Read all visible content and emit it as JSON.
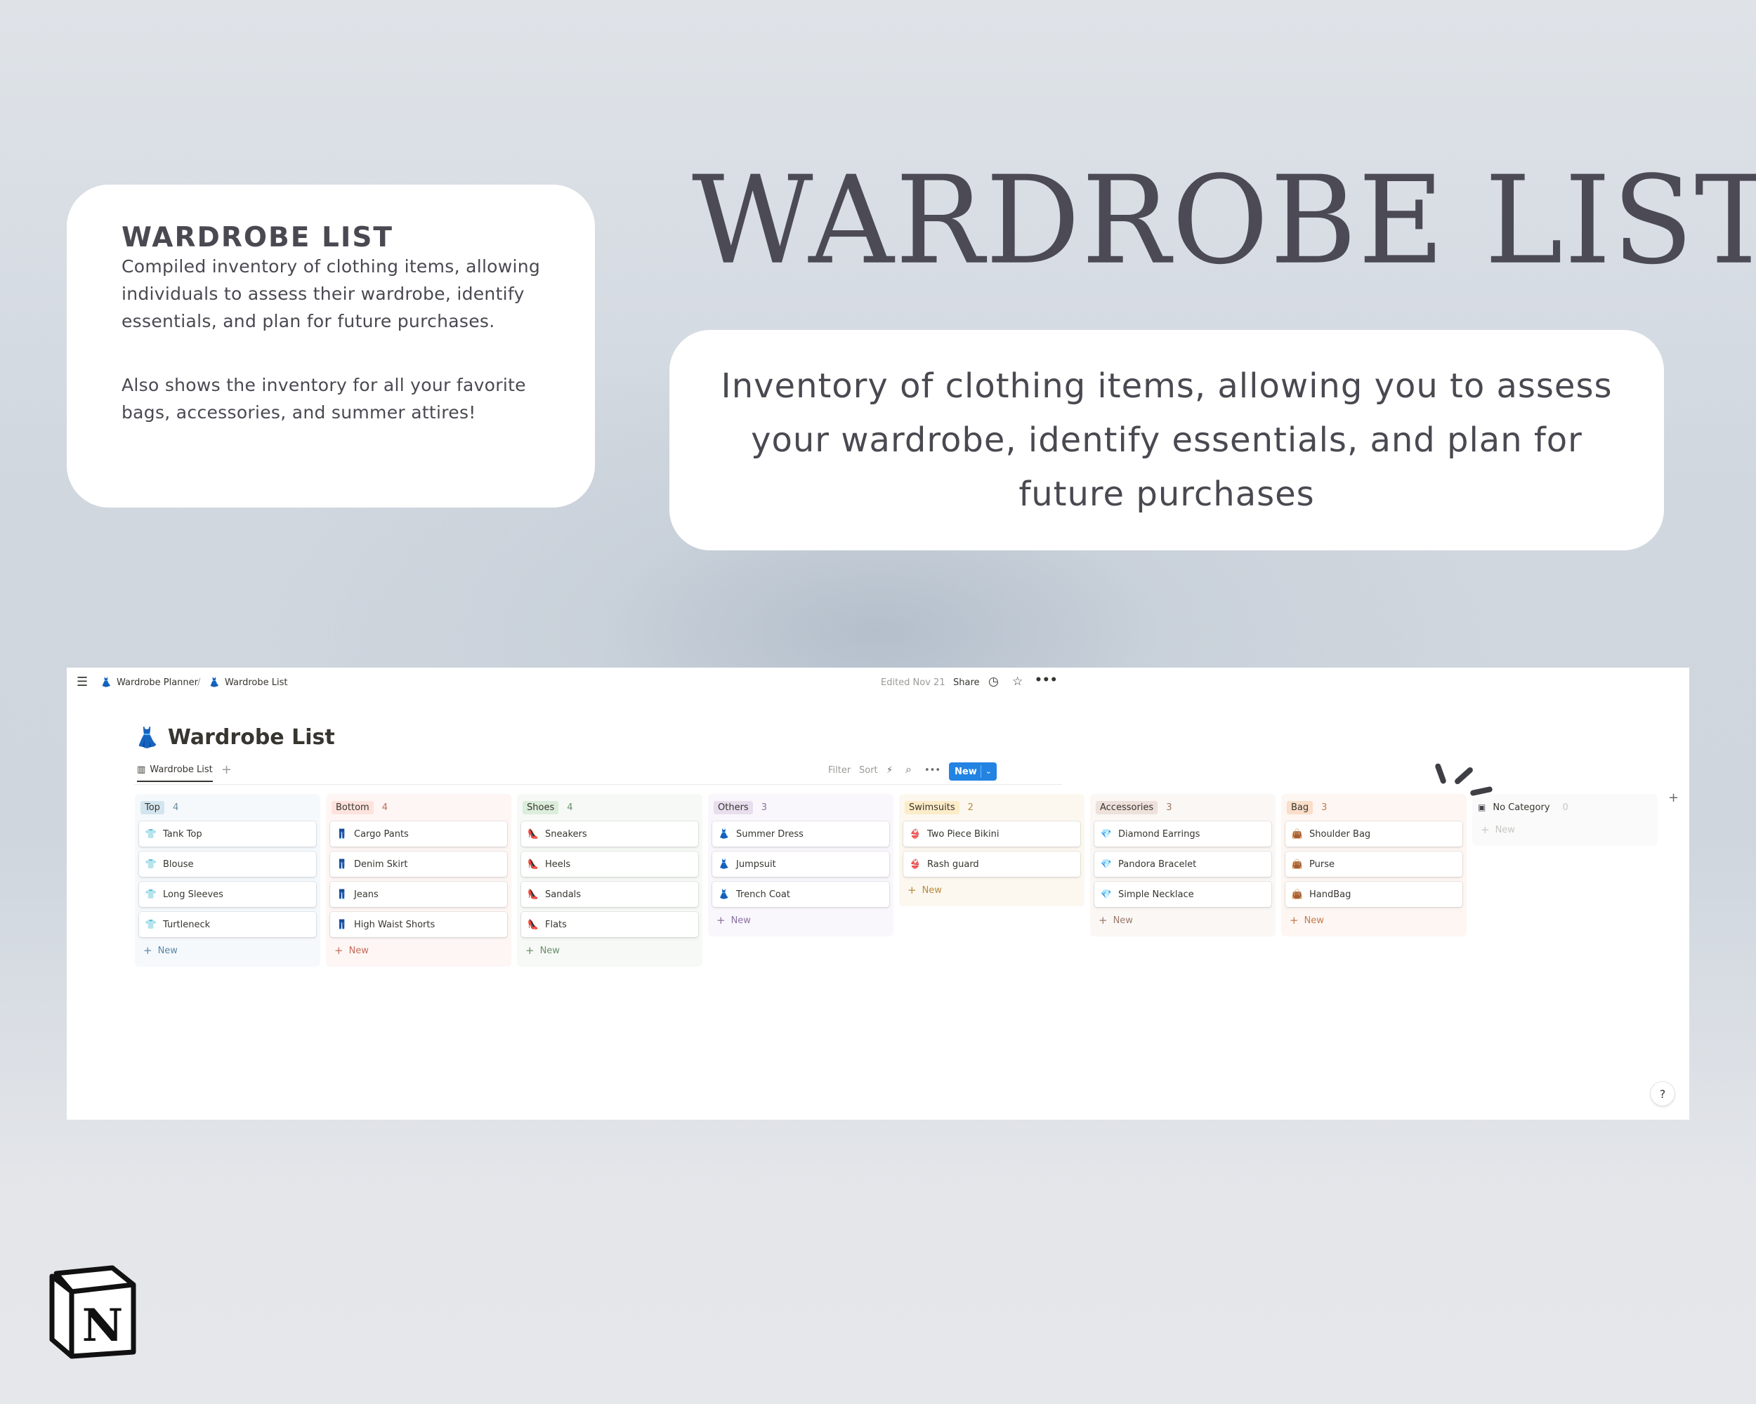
{
  "info_card": {
    "title": "WARDROBE LIST",
    "body": "Compiled inventory of clothing items, allowing individuals to assess their wardrobe, identify essentials, and plan for future purchases.",
    "body2": "Also shows the inventory for all your favorite bags, accessories, and summer attires!"
  },
  "hero": {
    "title": "WARDROBE LIST",
    "description": "Inventory of clothing items, allowing you to assess your wardrobe, identify essentials, and plan for future purchases"
  },
  "notion": {
    "breadcrumb": [
      "Wardrobe Planner",
      "/",
      "Wardrobe List"
    ],
    "edited": "Edited Nov 21",
    "share": "Share",
    "page_title": "Wardrobe List",
    "view_tab": "Wardrobe List",
    "toolbar": {
      "filter": "Filter",
      "sort": "Sort",
      "new": "New"
    },
    "new_label": "New",
    "add_column": "+",
    "help": "?",
    "columns": [
      {
        "name": "Top",
        "count": "4",
        "color": "#f5f9fc",
        "tag_color": "#d3e5ef",
        "count_color": "#6c8a9c",
        "icon": "shirt-icon",
        "glyph": "👕",
        "items": [
          "Tank Top",
          "Blouse",
          "Long Sleeves",
          "Turtleneck"
        ],
        "new_color": "#5a87a8"
      },
      {
        "name": "Bottom",
        "count": "4",
        "color": "#fdf6f4",
        "tag_color": "#ffe2dd",
        "count_color": "#c46b5c",
        "icon": "pants-icon",
        "glyph": "👖",
        "items": [
          "Cargo Pants",
          "Denim Skirt",
          "Jeans",
          "High Waist Shorts"
        ],
        "new_color": "#c46b5c"
      },
      {
        "name": "Shoes",
        "count": "4",
        "color": "#f6f9f6",
        "tag_color": "#dbeddb",
        "count_color": "#6b8f6b",
        "icon": "heel-icon",
        "glyph": "👠",
        "items": [
          "Sneakers",
          "Heels",
          "Sandals",
          "Flats"
        ],
        "new_color": "#6b8f6b"
      },
      {
        "name": "Others",
        "count": "3",
        "color": "#f9f7fc",
        "tag_color": "#e8deee",
        "count_color": "#8b72a0",
        "icon": "dress-icon",
        "glyph": "👗",
        "items": [
          "Summer Dress",
          "Jumpsuit",
          "Trench Coat"
        ],
        "new_color": "#8b72a0"
      },
      {
        "name": "Swimsuits",
        "count": "2",
        "color": "#fcf8f0",
        "tag_color": "#fdecc8",
        "count_color": "#b88a3a",
        "icon": "bikini-icon",
        "glyph": "👙",
        "items": [
          "Two Piece Bikini",
          "Rash guard"
        ],
        "new_color": "#b88a3a"
      },
      {
        "name": "Accessories",
        "count": "3",
        "color": "#faf7f5",
        "tag_color": "#eee0da",
        "count_color": "#9a7a6a",
        "icon": "gem-icon",
        "glyph": "💎",
        "items": [
          "Diamond Earrings",
          "Pandora Bracelet",
          "Simple Necklace"
        ],
        "new_color": "#9a7a6a"
      },
      {
        "name": "Bag",
        "count": "3",
        "color": "#fdf6f2",
        "tag_color": "#fadec9",
        "count_color": "#c27a50",
        "icon": "bag-icon",
        "glyph": "👜",
        "items": [
          "Shoulder Bag",
          "Purse",
          "HandBag"
        ],
        "new_color": "#c27a50"
      },
      {
        "name": "No Category",
        "count": "0",
        "color": "#fafafa",
        "tag_color": "transparent",
        "count_color": "#c8c7c4",
        "icon": "inbox-icon",
        "glyph": "📥",
        "items": [],
        "new_color": "#c8c7c4"
      }
    ]
  },
  "colors": {
    "accent": "#2383e2",
    "icon_pink": "#c2458d",
    "text": "#37352f"
  }
}
